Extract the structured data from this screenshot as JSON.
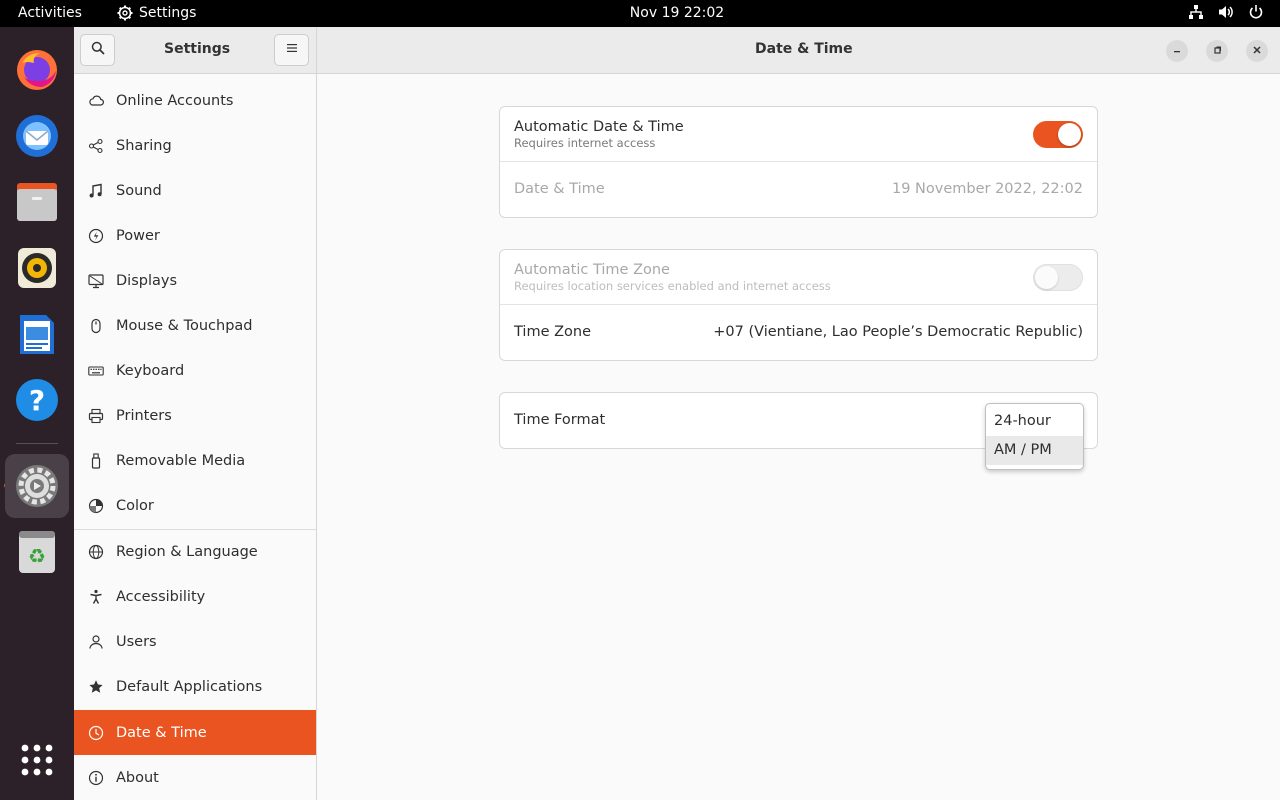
{
  "topbar": {
    "activities": "Activities",
    "app_name": "Settings",
    "clock": "Nov 19  22:02"
  },
  "dock": {
    "apps": [
      "firefox-icon",
      "thunderbird-icon",
      "files-icon",
      "rhythmbox-icon",
      "writer-icon",
      "help-icon",
      "settings-icon",
      "trash-icon",
      "app-grid-icon"
    ]
  },
  "header": {
    "sidebar_title": "Settings",
    "page_title": "Date & Time"
  },
  "sidebar": {
    "items": [
      {
        "label": "Online Accounts",
        "icon": "cloud-icon"
      },
      {
        "label": "Sharing",
        "icon": "share-icon"
      },
      {
        "label": "Sound",
        "icon": "music-note-icon"
      },
      {
        "label": "Power",
        "icon": "power-icon"
      },
      {
        "label": "Displays",
        "icon": "display-icon"
      },
      {
        "label": "Mouse & Touchpad",
        "icon": "mouse-icon"
      },
      {
        "label": "Keyboard",
        "icon": "keyboard-icon"
      },
      {
        "label": "Printers",
        "icon": "printer-icon"
      },
      {
        "label": "Removable Media",
        "icon": "usb-icon"
      },
      {
        "label": "Color",
        "icon": "color-icon"
      },
      {
        "label": "Region & Language",
        "icon": "globe-icon"
      },
      {
        "label": "Accessibility",
        "icon": "accessibility-icon"
      },
      {
        "label": "Users",
        "icon": "users-icon"
      },
      {
        "label": "Default Applications",
        "icon": "star-icon"
      },
      {
        "label": "Date & Time",
        "icon": "clock-icon",
        "selected": true
      },
      {
        "label": "About",
        "icon": "info-icon"
      }
    ]
  },
  "datetime": {
    "auto_datetime_label": "Automatic Date & Time",
    "auto_datetime_sub": "Requires internet access",
    "auto_datetime_on": true,
    "datetime_label": "Date & Time",
    "datetime_value": "19 November 2022, 22:02",
    "auto_timezone_label": "Automatic Time Zone",
    "auto_timezone_sub": "Requires location services enabled and internet access",
    "auto_timezone_on": false,
    "timezone_label": "Time Zone",
    "timezone_value": "+07 (Vientiane, Lao People’s Democratic Republic)",
    "time_format_label": "Time Format",
    "time_format_options": [
      "24-hour",
      "AM / PM"
    ]
  },
  "colors": {
    "accent": "#e95420",
    "dock_bg": "#2c2128"
  }
}
